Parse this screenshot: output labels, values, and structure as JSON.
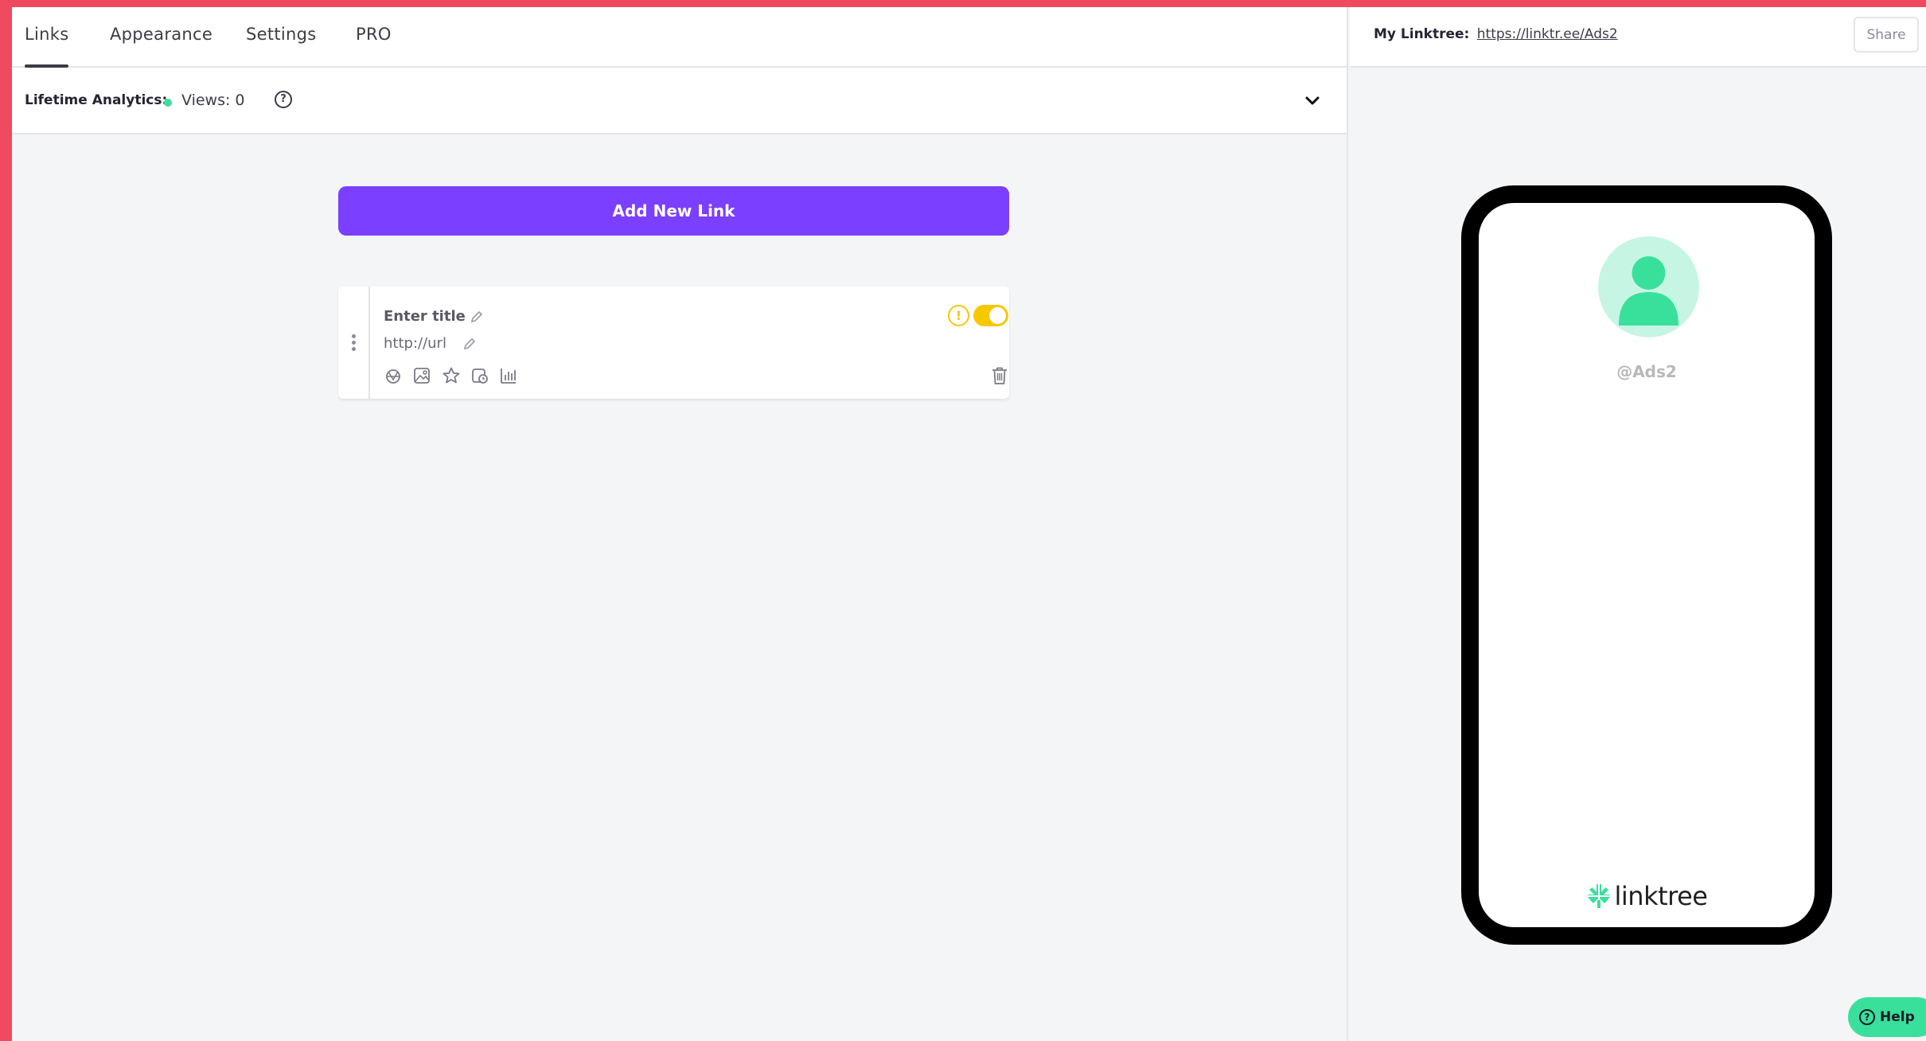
{
  "tabs": [
    {
      "label": "Links",
      "active": true
    },
    {
      "label": "Appearance",
      "active": false
    },
    {
      "label": "Settings",
      "active": false
    },
    {
      "label": "PRO",
      "active": false
    }
  ],
  "analytics": {
    "label": "Lifetime Analytics:",
    "views": "Views: 0",
    "help_icon": "question-circle-icon",
    "expand_icon": "chevron-down-icon",
    "status_color": "#39e09b"
  },
  "add_link": {
    "label": "Add New Link",
    "color": "#7b3fff"
  },
  "link_card": {
    "title_placeholder": "Enter title",
    "url_placeholder": "http://url",
    "warning_symbol": "!",
    "enabled": true,
    "toggle_color": "#f7c800",
    "tools": [
      "layout-icon",
      "thumbnail-icon",
      "star-icon",
      "schedule-icon",
      "analytics-icon"
    ],
    "delete_icon": "trash-icon"
  },
  "preview": {
    "my_linktree_label": "My Linktree:",
    "my_linktree_url": "https://linktr.ee/Ads2",
    "share_label": "Share",
    "handle": "@Ads2",
    "brand": "linktree",
    "brand_color": "#39e09b"
  },
  "help": {
    "label": "Help",
    "symbol": "?"
  }
}
